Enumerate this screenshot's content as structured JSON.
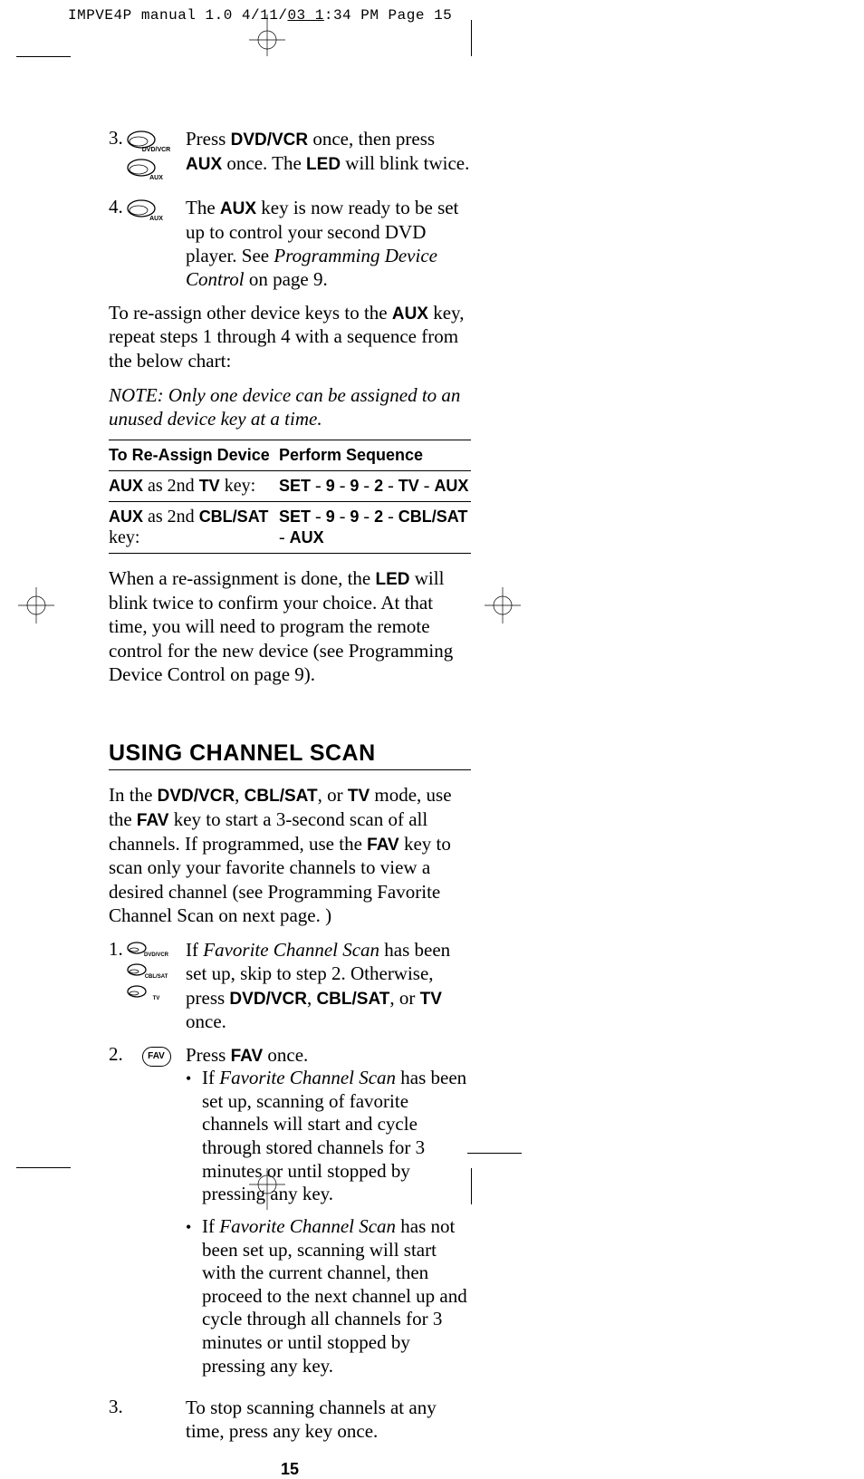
{
  "slug": {
    "prefix": "IMPVE4P manual 1.0  4/11/",
    "underlined": "03  1",
    "mid": ":34 PM  Page ",
    "pageno": "15"
  },
  "steps_top": [
    {
      "num": "3.",
      "icons": [
        {
          "label": "DVD/VCR"
        },
        {
          "label": "AUX"
        }
      ],
      "text_parts": [
        {
          "t": "Press ",
          "c": ""
        },
        {
          "t": "DVD/VCR",
          "c": "b"
        },
        {
          "t": " once, then press ",
          "c": ""
        },
        {
          "t": "AUX",
          "c": "b"
        },
        {
          "t": " once. The ",
          "c": ""
        },
        {
          "t": "LED",
          "c": "b"
        },
        {
          "t": " will blink twice.",
          "c": ""
        }
      ]
    },
    {
      "num": "4.",
      "icons": [
        {
          "label": "AUX"
        }
      ],
      "text_parts": [
        {
          "t": "The ",
          "c": ""
        },
        {
          "t": "AUX",
          "c": "b"
        },
        {
          "t": " key is now ready to be set up to control your second DVD player. See ",
          "c": ""
        },
        {
          "t": "Programming Device Control",
          "c": "i"
        },
        {
          "t": " on page 9.",
          "c": ""
        }
      ]
    }
  ],
  "reassign_para_parts": [
    {
      "t": "To re-assign other device keys to the ",
      "c": ""
    },
    {
      "t": "AUX",
      "c": "b"
    },
    {
      "t": " key, repeat steps 1 through 4 with a sequence from the below chart:",
      "c": ""
    }
  ],
  "note_text": "NOTE: Only one device can be assigned to an unused device key at a time.",
  "table": {
    "headers": [
      "To Re-Assign Device",
      "Perform Sequence"
    ],
    "rows": [
      {
        "left_parts": [
          {
            "t": "AUX",
            "c": "b"
          },
          {
            "t": " as 2nd ",
            "c": "r"
          },
          {
            "t": "TV",
            "c": "b"
          },
          {
            "t": " key:",
            "c": "r"
          }
        ],
        "right_parts": [
          {
            "t": "SET",
            "c": "b"
          },
          {
            "t": " - ",
            "c": "r"
          },
          {
            "t": "9",
            "c": "b"
          },
          {
            "t": " - ",
            "c": "r"
          },
          {
            "t": "9",
            "c": "b"
          },
          {
            "t": " - ",
            "c": "r"
          },
          {
            "t": "2",
            "c": "b"
          },
          {
            "t": " - ",
            "c": "r"
          },
          {
            "t": "TV",
            "c": "b"
          },
          {
            "t": " - ",
            "c": "r"
          },
          {
            "t": "AUX",
            "c": "b"
          }
        ]
      },
      {
        "left_parts": [
          {
            "t": "AUX",
            "c": "b"
          },
          {
            "t": " as 2nd ",
            "c": "r"
          },
          {
            "t": "CBL/SAT",
            "c": "b"
          },
          {
            "t": " key:",
            "c": "r"
          }
        ],
        "right_parts": [
          {
            "t": "SET",
            "c": "b"
          },
          {
            "t": " - ",
            "c": "r"
          },
          {
            "t": "9",
            "c": "b"
          },
          {
            "t": " - ",
            "c": "r"
          },
          {
            "t": "9",
            "c": "b"
          },
          {
            "t": " - ",
            "c": "r"
          },
          {
            "t": "2",
            "c": "b"
          },
          {
            "t": " - ",
            "c": "r"
          },
          {
            "t": "CBL/SAT",
            "c": "b"
          },
          {
            "t": " - ",
            "c": "r"
          },
          {
            "t": "AUX",
            "c": "b"
          }
        ]
      }
    ]
  },
  "confirm_para_parts": [
    {
      "t": "When a re-assignment is done, the ",
      "c": ""
    },
    {
      "t": "LED",
      "c": "b"
    },
    {
      "t": " will blink twice to confirm your choice. At that time, you will need to program the remote control for the new device (see ",
      "c": ""
    },
    {
      "t": "Programming Device Control",
      "c": "i"
    },
    {
      "t": " on page 9).",
      "c": ""
    }
  ],
  "section_heading": "USING CHANNEL SCAN",
  "scan_intro_parts": [
    {
      "t": "In the ",
      "c": ""
    },
    {
      "t": "DVD/VCR",
      "c": "b"
    },
    {
      "t": ", ",
      "c": ""
    },
    {
      "t": "CBL/SAT",
      "c": "b"
    },
    {
      "t": ", or ",
      "c": ""
    },
    {
      "t": "TV",
      "c": "b"
    },
    {
      "t": " mode, use the ",
      "c": ""
    },
    {
      "t": "FAV",
      "c": "b"
    },
    {
      "t": " key to start a 3-second scan of all channels. If programmed, use the ",
      "c": ""
    },
    {
      "t": "FAV",
      "c": "b"
    },
    {
      "t": " key to scan only your favorite channels to view a desired channel (see ",
      "c": ""
    },
    {
      "t": "Programming Favorite Channel Scan",
      "c": "i"
    },
    {
      "t": " on next page. )",
      "c": ""
    }
  ],
  "scan_steps": [
    {
      "num": "1.",
      "icon_style": "stack3",
      "icons": [
        {
          "label": "DVD/VCR"
        },
        {
          "label": "CBL/SAT"
        },
        {
          "label": "TV"
        }
      ],
      "text_parts": [
        {
          "t": "If ",
          "c": ""
        },
        {
          "t": "Favorite Channel Scan",
          "c": "i"
        },
        {
          "t": " has been set up, skip to step 2. Otherwise, press ",
          "c": ""
        },
        {
          "t": "DVD/VCR",
          "c": "b"
        },
        {
          "t": ", ",
          "c": ""
        },
        {
          "t": "CBL/SAT",
          "c": "b"
        },
        {
          "t": ", or ",
          "c": ""
        },
        {
          "t": "TV",
          "c": "b"
        },
        {
          "t": " once.",
          "c": ""
        }
      ]
    },
    {
      "num": "2.",
      "icon_style": "round",
      "round_label": "FAV",
      "text_parts": [
        {
          "t": "Press ",
          "c": ""
        },
        {
          "t": "FAV",
          "c": "b"
        },
        {
          "t": " once.",
          "c": ""
        }
      ],
      "bullets": [
        [
          {
            "t": "If ",
            "c": ""
          },
          {
            "t": "Favorite Channel Scan",
            "c": "i"
          },
          {
            "t": " has been set up, scanning of favorite channels will start and cycle through stored channels for 3 minutes or until stopped by pressing any key.",
            "c": ""
          }
        ],
        [
          {
            "t": "If ",
            "c": ""
          },
          {
            "t": "Favorite Channel Scan",
            "c": "i"
          },
          {
            "t": " has not been set up, scanning will start with the current channel, then proceed to the next channel up and cycle through all channels for 3 minutes or until stopped by pressing any key.",
            "c": ""
          }
        ]
      ]
    },
    {
      "num": "3.",
      "icon_style": "none",
      "text_parts": [
        {
          "t": "To stop scanning channels at any time, press any key once.",
          "c": ""
        }
      ]
    }
  ],
  "page_number": "15"
}
